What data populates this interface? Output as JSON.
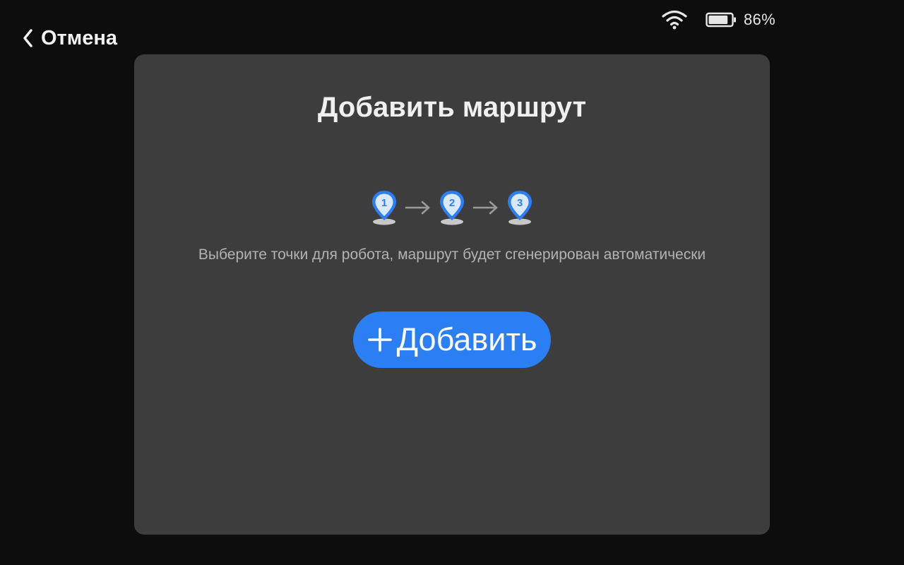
{
  "status": {
    "battery_text": "86%",
    "battery_level": 0.86,
    "icons": [
      "wifi-icon",
      "battery-icon"
    ]
  },
  "nav": {
    "cancel_label": "Отмена",
    "cancel_icon": "chevron-left-icon"
  },
  "card": {
    "title": "Добавить маршрут",
    "steps": [
      "1",
      "2",
      "3"
    ],
    "step_icon": "location-pin-icon",
    "step_color": "#2b7ff2",
    "hint": "Выберите точки для робота, маршрут будет сгенерирован автоматически",
    "add_button": {
      "label": "Добавить",
      "icon": "plus-icon",
      "color": "#2b7ff2"
    }
  },
  "colors": {
    "background": "#0d0d0d",
    "card": "#3d3d3d",
    "accent": "#2b7ff2"
  }
}
